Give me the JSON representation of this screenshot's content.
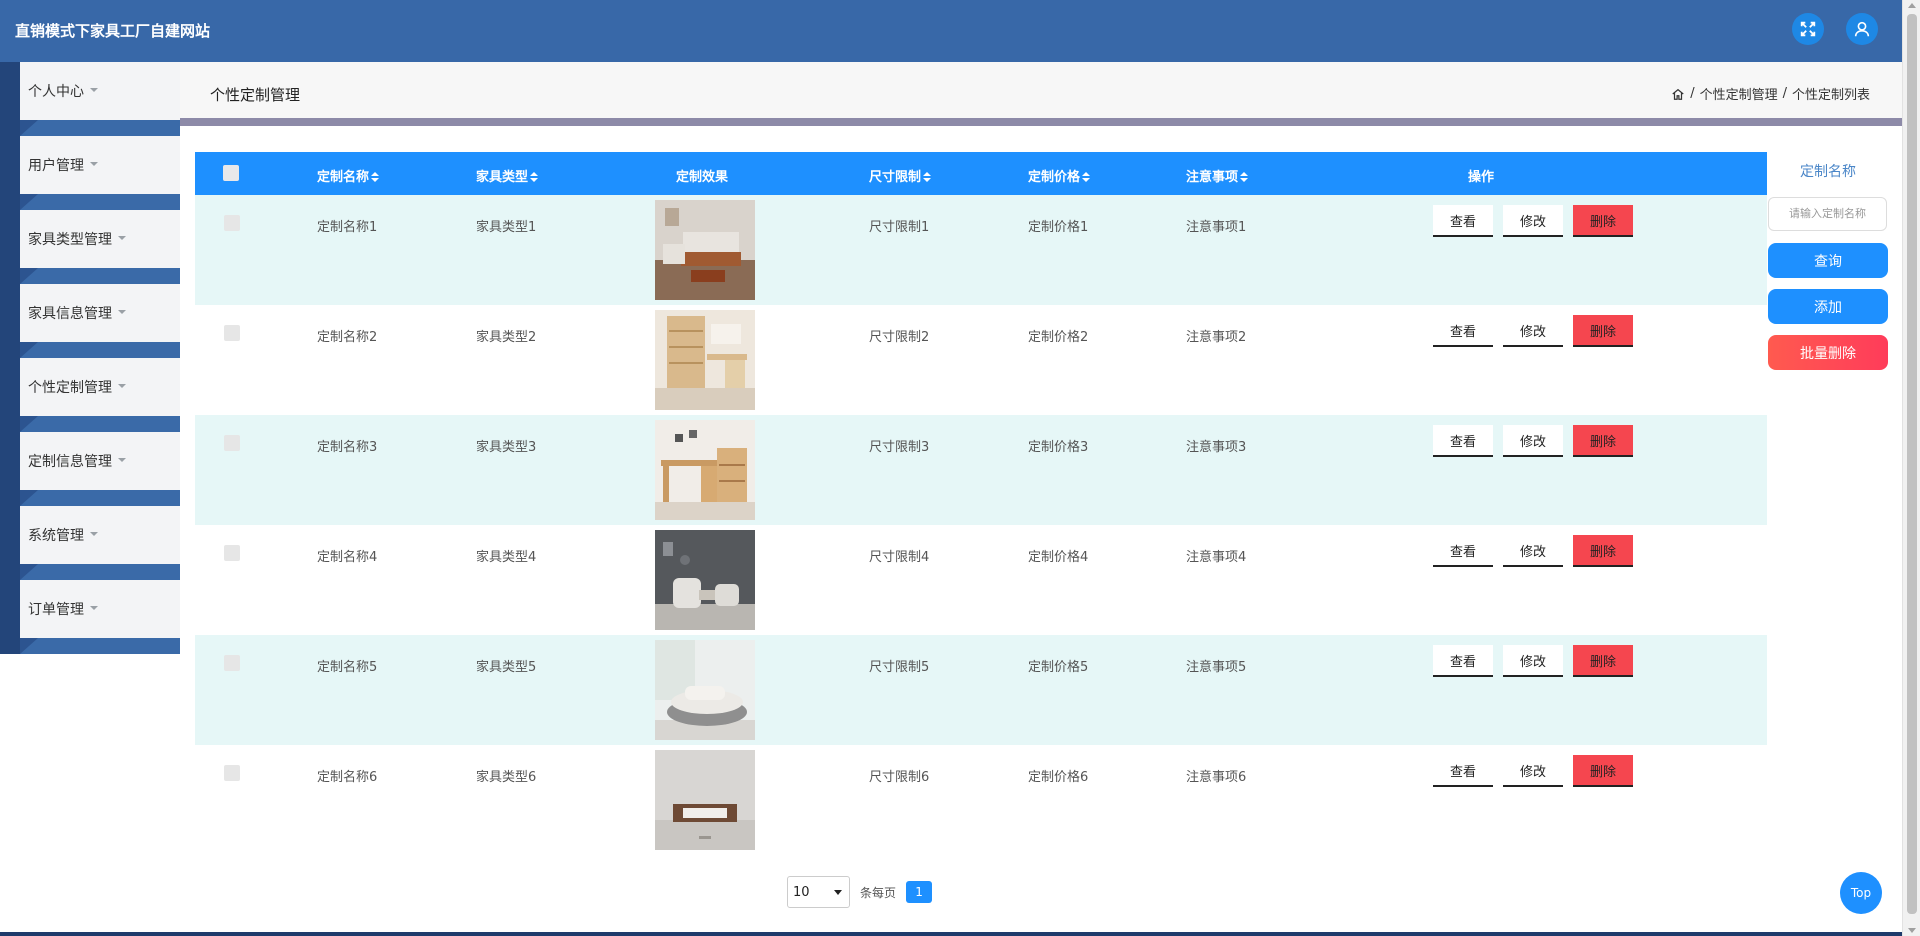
{
  "app": {
    "title": "直销模式下家具工厂自建网站"
  },
  "sidebar": {
    "items": [
      {
        "label": "个人中心"
      },
      {
        "label": "用户管理"
      },
      {
        "label": "家具类型管理"
      },
      {
        "label": "家具信息管理"
      },
      {
        "label": "个性定制管理"
      },
      {
        "label": "定制信息管理"
      },
      {
        "label": "系统管理"
      },
      {
        "label": "订单管理"
      }
    ]
  },
  "page": {
    "title": "个性定制管理",
    "breadcrumb": [
      "个性定制管理",
      "个性定制列表"
    ],
    "breadcrumb_sep": "/"
  },
  "table": {
    "columns": [
      "定制名称",
      "家具类型",
      "定制效果",
      "尺寸限制",
      "定制价格",
      "注意事项",
      "操作"
    ],
    "actions": {
      "view": "查看",
      "edit": "修改",
      "delete": "删除"
    },
    "rows": [
      {
        "name": "定制名称1",
        "type": "家具类型1",
        "size": "尺寸限制1",
        "price": "定制价格1",
        "note": "注意事项1"
      },
      {
        "name": "定制名称2",
        "type": "家具类型2",
        "size": "尺寸限制2",
        "price": "定制价格2",
        "note": "注意事项2"
      },
      {
        "name": "定制名称3",
        "type": "家具类型3",
        "size": "尺寸限制3",
        "price": "定制价格3",
        "note": "注意事项3"
      },
      {
        "name": "定制名称4",
        "type": "家具类型4",
        "size": "尺寸限制4",
        "price": "定制价格4",
        "note": "注意事项4"
      },
      {
        "name": "定制名称5",
        "type": "家具类型5",
        "size": "尺寸限制5",
        "price": "定制价格5",
        "note": "注意事项5"
      },
      {
        "name": "定制名称6",
        "type": "家具类型6",
        "size": "尺寸限制6",
        "price": "定制价格6",
        "note": "注意事项6"
      }
    ]
  },
  "search": {
    "label": "定制名称",
    "placeholder": "请输入定制名称",
    "query_btn": "查询",
    "add_btn": "添加",
    "batch_delete_btn": "批量删除"
  },
  "pagination": {
    "page_size": "10",
    "per_page_label": "条每页",
    "current_page": "1"
  },
  "top_button": "Top",
  "colors": {
    "header": "#3868a8",
    "primary": "#1e90ff",
    "danger": "#f5464f",
    "row_alt": "#e6f7f7"
  }
}
